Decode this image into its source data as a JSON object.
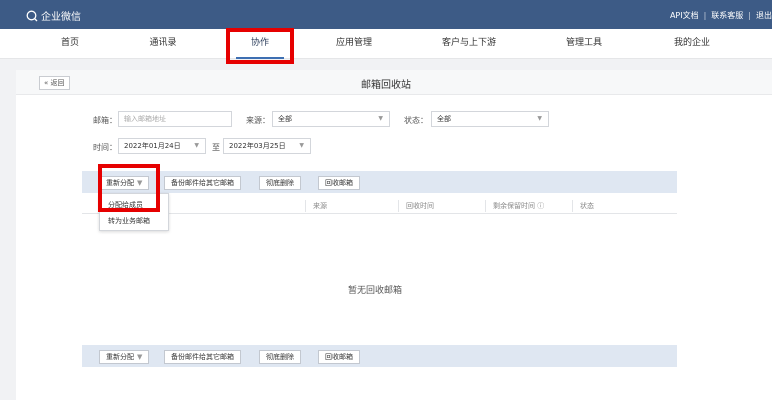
{
  "app": {
    "name": "企业微信"
  },
  "header": {
    "links": [
      "API文档",
      "联系客服",
      "退出"
    ]
  },
  "nav": {
    "items": [
      {
        "label": "首页"
      },
      {
        "label": "通讯录"
      },
      {
        "label": "协作",
        "active": true
      },
      {
        "label": "应用管理"
      },
      {
        "label": "客户与上下游"
      },
      {
        "label": "管理工具"
      },
      {
        "label": "我的企业"
      }
    ]
  },
  "page": {
    "back": "« 返回",
    "title": "邮箱回收站"
  },
  "filters": {
    "mailbox_label": "邮箱：",
    "mailbox_placeholder": "输入邮箱地址",
    "source_label": "来源：",
    "source_value": "全部",
    "status_label": "状态：",
    "status_value": "全部",
    "time_label": "时间：",
    "start_date": "2022年01月24日",
    "to_label": "至",
    "end_date": "2022年03月25日"
  },
  "toolbar": {
    "reassign": "重新分配",
    "backup": "备份邮件给其它邮箱",
    "delete": "彻底删除",
    "recycle": "回收邮箱"
  },
  "dropdown": {
    "items": [
      "分配给成员",
      "转为业务邮箱"
    ]
  },
  "table": {
    "columns": [
      "来源",
      "回收时间",
      "剩余保留时间",
      "状态"
    ]
  },
  "empty_text": "暂无回收邮箱",
  "colors": {
    "topbar": "#3d5b86",
    "toolbar": "#dfe7f2",
    "highlight": "#e60000"
  }
}
